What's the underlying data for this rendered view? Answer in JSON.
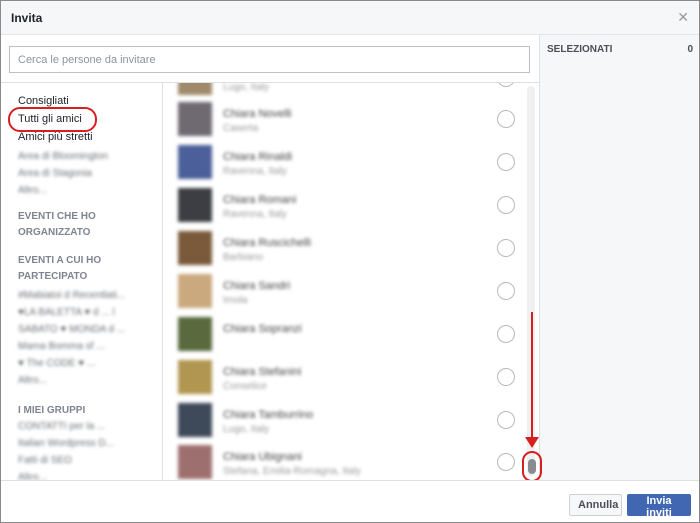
{
  "header": {
    "title": "Invita",
    "close_glyph": "✕"
  },
  "search": {
    "placeholder": "Cerca le persone da invitare"
  },
  "selected": {
    "label": "SELEZIONATI",
    "count": "0"
  },
  "sidebar": {
    "items": [
      {
        "label": "Consigliati"
      },
      {
        "label": "Tutti gli amici"
      },
      {
        "label": "Amici più stretti"
      }
    ],
    "list_blur": [
      "Area di Bloomington",
      "Area di Stagonia",
      "Altro..."
    ],
    "events_created_heading": "EVENTI CHE HO ORGANIZZATO",
    "events_attended_heading": "EVENTI A CUI HO PARTECIPATO",
    "events_blur": [
      "#Mabiatoi d Recentlati...",
      "♥LA BALETTA ♥ d ... l",
      "SABATO ♥ MONDA d ...",
      "Mama Bomma sf ...",
      "♥ The CODE ♥ ...",
      "Altro..."
    ],
    "groups_heading": "I MIEI GRUPPI",
    "groups_blur": [
      "CONTATTI per la ...",
      "Italian Wordpress D...",
      "Fatti di SEO",
      "Altro..."
    ]
  },
  "friends": [
    {
      "name": "",
      "location": "Lugo, Italy",
      "avatar_color": "#a08a6c"
    },
    {
      "name": "Chiara Novelli",
      "location": "Caserta",
      "avatar_color": "#6f6a72"
    },
    {
      "name": "Chiara Rinaldi",
      "location": "Ravenna, Italy",
      "avatar_color": "#4b5f9a"
    },
    {
      "name": "Chiara Romani",
      "location": "Ravenna, Italy",
      "avatar_color": "#3c3e44"
    },
    {
      "name": "Chiara Ruscichelli",
      "location": "Barbiano",
      "avatar_color": "#7a5a3b"
    },
    {
      "name": "Chiara Sandri",
      "location": "Imola",
      "avatar_color": "#c9a97d"
    },
    {
      "name": "Chiara Sopranzi",
      "location": "",
      "avatar_color": "#5a6a3e"
    },
    {
      "name": "Chiara Stefanini",
      "location": "Conselice",
      "avatar_color": "#b09650"
    },
    {
      "name": "Chiara Tamburrino",
      "location": "Lugo, Italy",
      "avatar_color": "#3e4a5a"
    },
    {
      "name": "Chiara Ubignani",
      "location": "Stefana, Emilia-Romagna, Italy",
      "avatar_color": "#9e6f6f"
    }
  ],
  "footer": {
    "cancel_label": "Annulla",
    "send_label": "Invia inviti"
  },
  "colors": {
    "accent": "#4267b2",
    "annotation": "#d81e1e"
  }
}
